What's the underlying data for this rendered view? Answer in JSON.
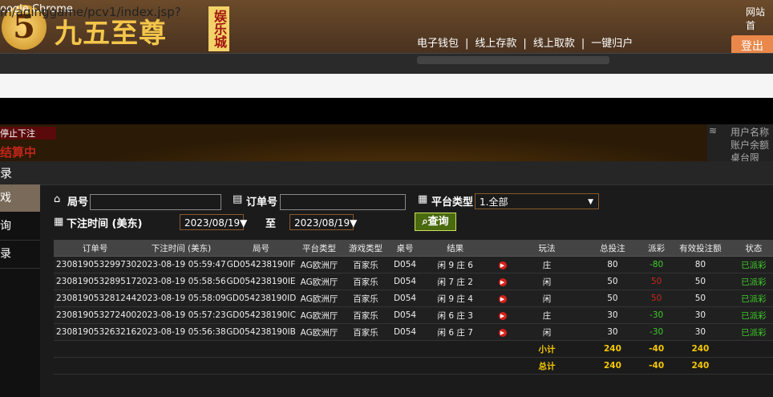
{
  "site": {
    "logo_number": "5",
    "logo_text": "九五至尊",
    "logo_badge": "娱乐城",
    "nav": [
      "电子钱包",
      "线上存款",
      "线上取款",
      "一键归户"
    ],
    "top_link": "网站首",
    "logout_label": "登出"
  },
  "browser": {
    "title": "oogle Chrome",
    "url": "m/aginggame/pcv1/index.jsp?"
  },
  "game": {
    "stop_label": "停止下注",
    "settling": "结算中",
    "right_info": [
      "用户名称",
      "账户余额",
      "桌台限"
    ]
  },
  "dialog": {
    "title": "录",
    "menu": [
      "戏",
      "询",
      "录"
    ]
  },
  "filters": {
    "round_label": "局号",
    "order_label": "订单号",
    "platform_label": "平台类型",
    "platform_value": "1.全部",
    "time_label": "下注时间 (美东)",
    "date_from": "2023/08/19",
    "to_label": "至",
    "date_to": "2023/08/19",
    "query_label": "查询"
  },
  "table": {
    "headers": [
      "订单号",
      "下注时间 (美东)",
      "局号",
      "平台类型",
      "游戏类型",
      "桌号",
      "结果",
      "",
      "玩法",
      "总投注",
      "派彩",
      "有效投注额",
      "状态"
    ],
    "rows": [
      [
        "230819053299730",
        "2023-08-19 05:59:47",
        "GD054238190IF",
        "AG欧洲厅",
        "百家乐",
        "D054",
        "闲 9 庄 6",
        "▶",
        "庄",
        "80",
        "-80",
        "80",
        "已派彩"
      ],
      [
        "230819053289517",
        "2023-08-19 05:58:56",
        "GD054238190IE",
        "AG欧洲厅",
        "百家乐",
        "D054",
        "闲 7 庄 2",
        "▶",
        "闲",
        "50",
        "50",
        "50",
        "已派彩"
      ],
      [
        "230819053281244",
        "2023-08-19 05:58:09",
        "GD054238190ID",
        "AG欧洲厅",
        "百家乐",
        "D054",
        "闲 9 庄 4",
        "▶",
        "闲",
        "50",
        "50",
        "50",
        "已派彩"
      ],
      [
        "230819053272400",
        "2023-08-19 05:57:23",
        "GD054238190IC",
        "AG欧洲厅",
        "百家乐",
        "D054",
        "闲 6 庄 3",
        "▶",
        "庄",
        "30",
        "-30",
        "30",
        "已派彩"
      ],
      [
        "230819053263216",
        "2023-08-19 05:56:38",
        "GD054238190IB",
        "AG欧洲厅",
        "百家乐",
        "D054",
        "闲 6 庄 7",
        "▶",
        "闲",
        "30",
        "-30",
        "30",
        "已派彩"
      ]
    ],
    "subtotal": {
      "label": "小计",
      "total_bet": "240",
      "payout": "-40",
      "valid_bet": "240"
    },
    "total": {
      "label": "总计",
      "total_bet": "240",
      "payout": "-40",
      "valid_bet": "240"
    }
  }
}
